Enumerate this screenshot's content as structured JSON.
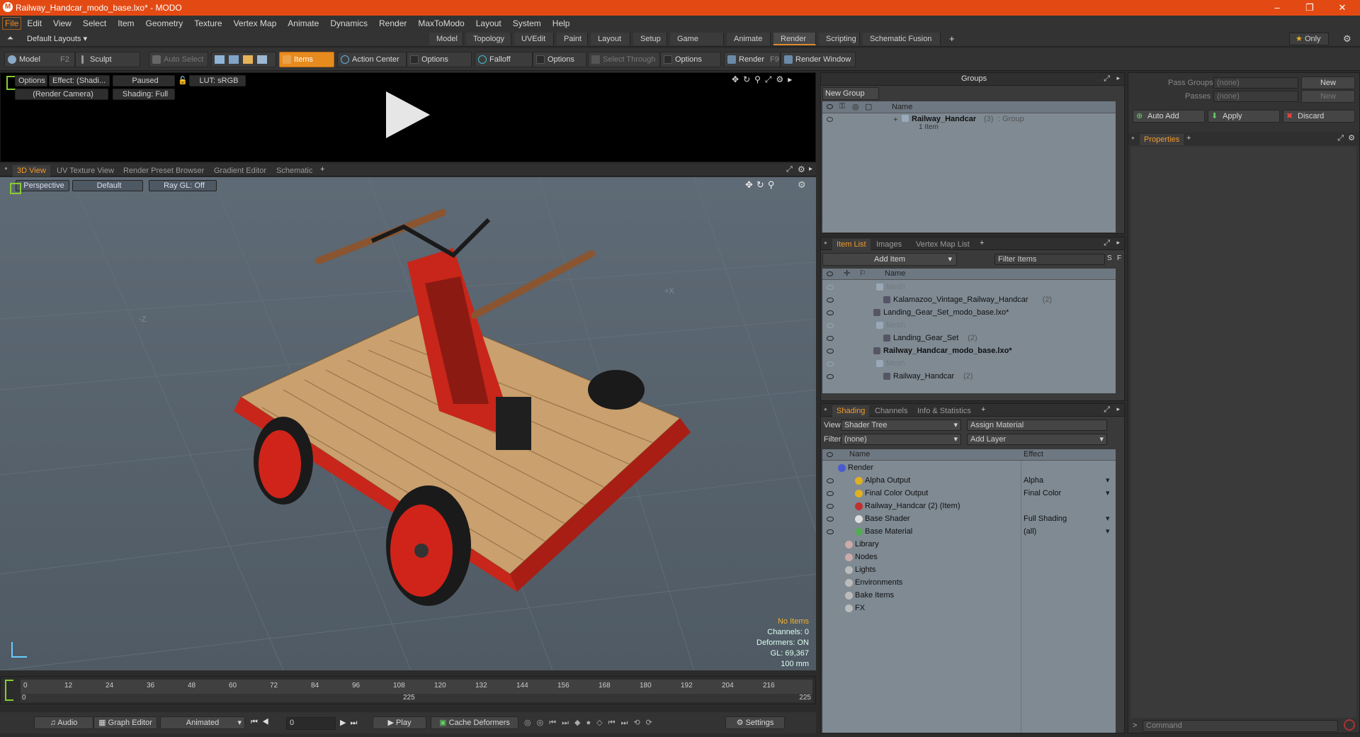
{
  "window": {
    "title": "Railway_Handcar_modo_base.lxo* - MODO",
    "logo": "M"
  },
  "menu": [
    "File",
    "Edit",
    "View",
    "Select",
    "Item",
    "Geometry",
    "Texture",
    "Vertex Map",
    "Animate",
    "Dynamics",
    "Render",
    "MaxToModo",
    "Layout",
    "System",
    "Help"
  ],
  "layoutbar": {
    "default_layouts": "Default Layouts ▾",
    "tabs": [
      "Model",
      "Topology",
      "UVEdit",
      "Paint",
      "Layout",
      "Setup",
      "Game Tools",
      "Animate",
      "Render",
      "Scripting",
      "Schematic Fusion"
    ],
    "active_tab": "Render",
    "only": "Only"
  },
  "toolbar": {
    "model": "Model",
    "model_key": "F2",
    "sculpt": "Sculpt",
    "auto_select": "Auto Select",
    "items": "Items",
    "action_center": "Action Center",
    "options1": "Options",
    "falloff": "Falloff",
    "options2": "Options",
    "select_through": "Select Through",
    "options3": "Options",
    "render": "Render",
    "render_key": "F9",
    "render_window": "Render Window"
  },
  "render_view": {
    "options": "Options",
    "effect": "Effect: (Shadi...",
    "paused": "Paused",
    "lut": "LUT: sRGB",
    "camera": "(Render Camera)",
    "shading": "Shading: Full"
  },
  "viewport": {
    "tabs": [
      "3D View",
      "UV Texture View",
      "Render Preset Browser",
      "Gradient Editor",
      "Schematic"
    ],
    "perspective": "Perspective",
    "default": "Default",
    "raygl": "Ray GL: Off",
    "axis_z": "-Z",
    "axis_x": "+X",
    "stats": [
      "No Items",
      "Channels: 0",
      "Deformers: ON",
      "GL: 69,367",
      "100 mm"
    ]
  },
  "timeline": {
    "ticks": [
      "0",
      "12",
      "24",
      "36",
      "48",
      "60",
      "72",
      "84",
      "96",
      "108",
      "120",
      "132",
      "144",
      "156",
      "168",
      "180",
      "192",
      "204",
      "216"
    ],
    "start": "0",
    "end": "225",
    "mid": "225"
  },
  "bottombar": {
    "audio": "Audio",
    "graph_editor": "Graph Editor",
    "animated": "Animated",
    "frame": "0",
    "play": "Play",
    "cache": "Cache Deformers",
    "settings": "Settings"
  },
  "groups": {
    "title": "Groups",
    "new_group": "New Group",
    "col_name": "Name",
    "item_name": "Railway_Handcar",
    "item_count": "(3)",
    "item_type": ": Group",
    "item_sub": "1 Item"
  },
  "item_list": {
    "tabs": [
      "Item List",
      "Images",
      "Vertex Map List"
    ],
    "add_item": "Add Item",
    "filter": "Filter Items",
    "col_name": "Name",
    "rows": [
      {
        "text": "Mesh",
        "suffix": "",
        "grey": true
      },
      {
        "text": "Kalamazoo_Vintage_Railway_Handcar",
        "suffix": "(2)",
        "grey": false
      },
      {
        "text": "Landing_Gear_Set_modo_base.lxo*",
        "suffix": "",
        "grey": false
      },
      {
        "text": "Mesh",
        "suffix": "",
        "grey": true
      },
      {
        "text": "Landing_Gear_Set",
        "suffix": "(2)",
        "grey": false
      },
      {
        "text": "Railway_Handcar_modo_base.lxo*",
        "suffix": "",
        "grey": false
      },
      {
        "text": "Mesh",
        "suffix": "",
        "grey": true
      },
      {
        "text": "Railway_Handcar",
        "suffix": "(2)",
        "grey": false
      }
    ]
  },
  "shading": {
    "tabs": [
      "Shading",
      "Channels",
      "Info & Statistics"
    ],
    "view_label": "View",
    "view_value": "Shader Tree",
    "assign": "Assign Material",
    "filter_label": "Filter",
    "filter_value": "(none)",
    "add_layer": "Add Layer",
    "col_name": "Name",
    "col_effect": "Effect",
    "rows": [
      {
        "name": "Render",
        "effect": ""
      },
      {
        "name": "Alpha Output",
        "effect": "Alpha"
      },
      {
        "name": "Final Color Output",
        "effect": "Final Color"
      },
      {
        "name": "Railway_Handcar (2) (Item)",
        "effect": ""
      },
      {
        "name": "Base Shader",
        "effect": "Full Shading"
      },
      {
        "name": "Base Material",
        "effect": "(all)"
      },
      {
        "name": "Library",
        "effect": ""
      },
      {
        "name": "Nodes",
        "effect": ""
      },
      {
        "name": "Lights",
        "effect": ""
      },
      {
        "name": "Environments",
        "effect": ""
      },
      {
        "name": "Bake Items",
        "effect": ""
      },
      {
        "name": "FX",
        "effect": ""
      }
    ]
  },
  "properties": {
    "pass_groups": "Pass Groups",
    "passes": "Passes",
    "none": "(none)",
    "new": "New",
    "auto_add": "Auto Add",
    "apply": "Apply",
    "discard": "Discard",
    "tab": "Properties",
    "command": "Command"
  },
  "colors": {
    "accent": "#e88b1e",
    "title": "#e34a13",
    "list_bg": "#7f8a93",
    "viewport_bg": "#5b6874"
  }
}
